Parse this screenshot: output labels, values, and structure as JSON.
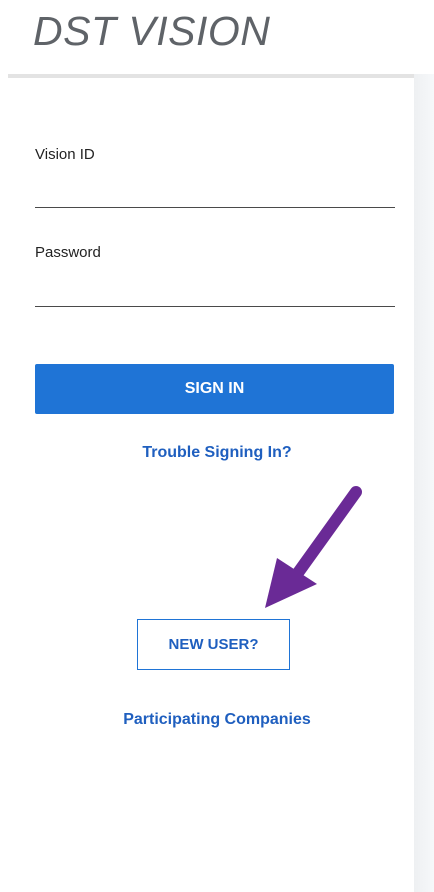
{
  "brand": {
    "title": "DST VISION"
  },
  "form": {
    "vision_id_label": "Vision ID",
    "vision_id_value": "",
    "password_label": "Password",
    "password_value": "",
    "sign_in_label": "SIGN IN",
    "trouble_link": "Trouble Signing In?",
    "new_user_label": "NEW USER?",
    "participating_link": "Participating Companies"
  },
  "annotation": {
    "arrow_icon": "purple-arrow-icon",
    "arrow_color": "#6a2a96"
  },
  "colors": {
    "primary": "#1f74d6",
    "link": "#1f5fbf",
    "brand_text": "#5f6368"
  }
}
